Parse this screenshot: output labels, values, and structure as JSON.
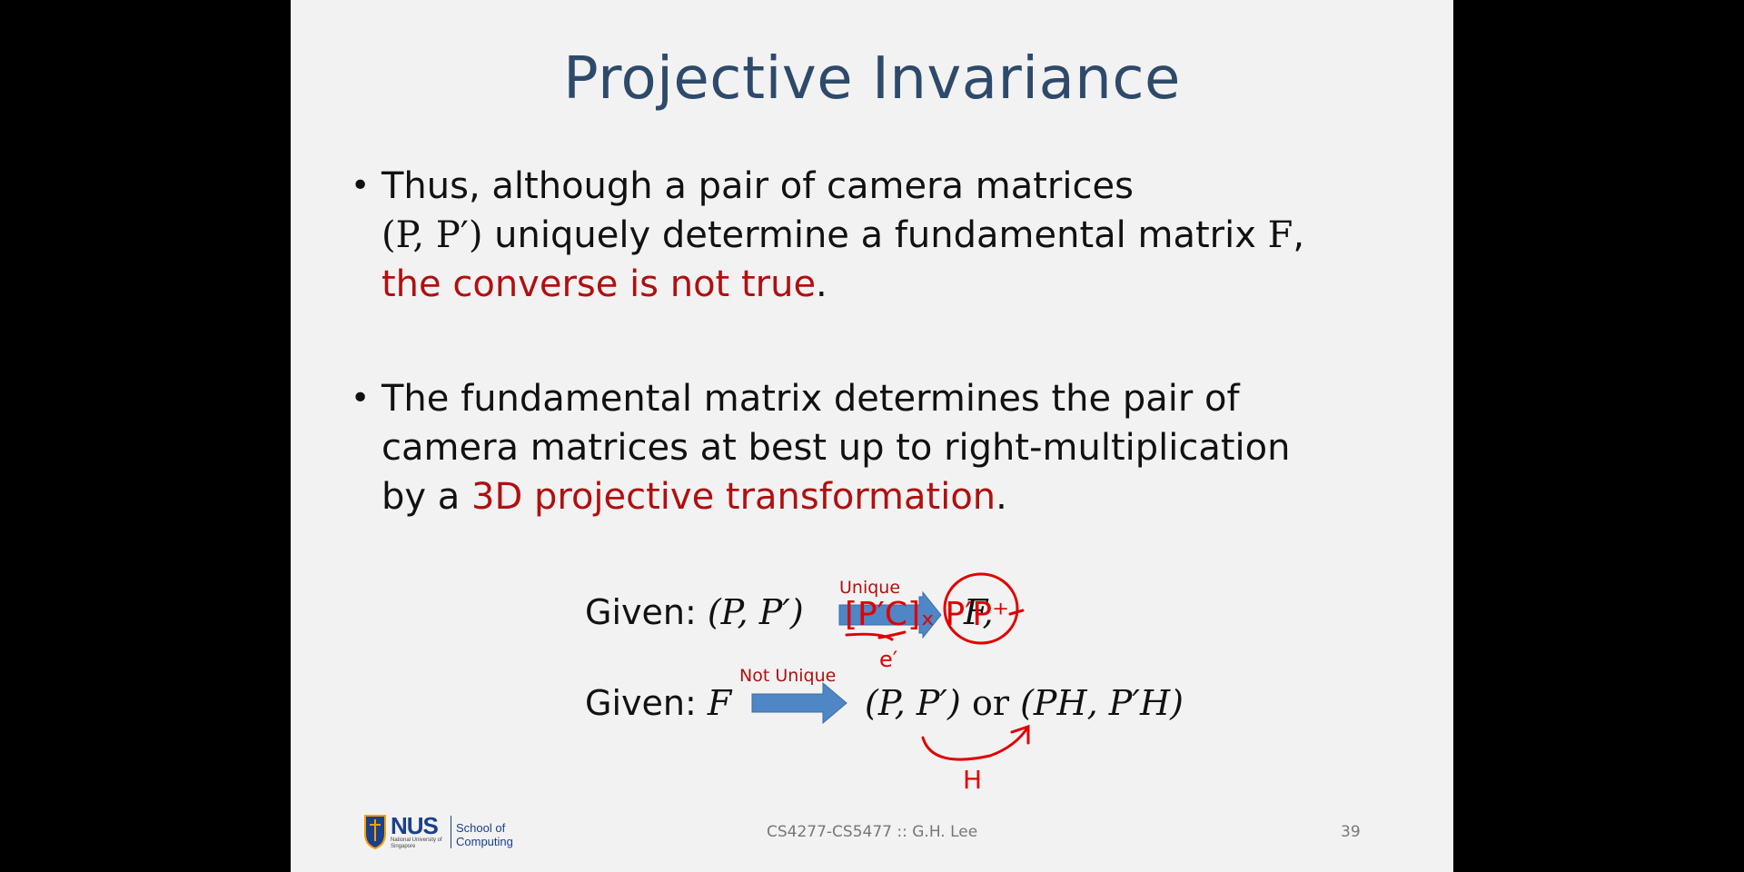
{
  "slide": {
    "title": "Projective Invariance",
    "bullet1": {
      "line1": "Thus, although a pair of camera matrices",
      "pair": "(P, P′)",
      "line2_rest": " uniquely determine a fundamental matrix ",
      "F": "F",
      "comma": ",",
      "red": "the converse is not true",
      "end": "."
    },
    "bullet2": {
      "line1": "The fundamental matrix determines the pair of",
      "line2": "camera matrices at best up to right-multiplication",
      "line3_start": "by a ",
      "red": "3D projective transformation",
      "end": "."
    },
    "eq1": {
      "given": "Given: ",
      "pair": "(P, P′)",
      "arrow_label": "Unique",
      "result": "F,"
    },
    "eq2": {
      "given": "Given: ",
      "F": "F",
      "arrow_label": "Not Unique",
      "result1": "(P, P′)",
      "or": " or ",
      "result2": "(PH, P′H)"
    },
    "annotations": {
      "upper": "[P′C]ₓ P′P⁺",
      "e_prime": "e′",
      "h": "H"
    },
    "footer": {
      "course": "CS4277-CS5477 :: G.H. Lee",
      "page": "39",
      "logo_name": "NUS",
      "logo_sub": "National University of Singapore",
      "school": "School of Computing"
    }
  },
  "colors": {
    "title": "#2e4a6b",
    "emphasis": "#b01010",
    "arrow": "#4f86c6",
    "ink": "#e00000"
  }
}
